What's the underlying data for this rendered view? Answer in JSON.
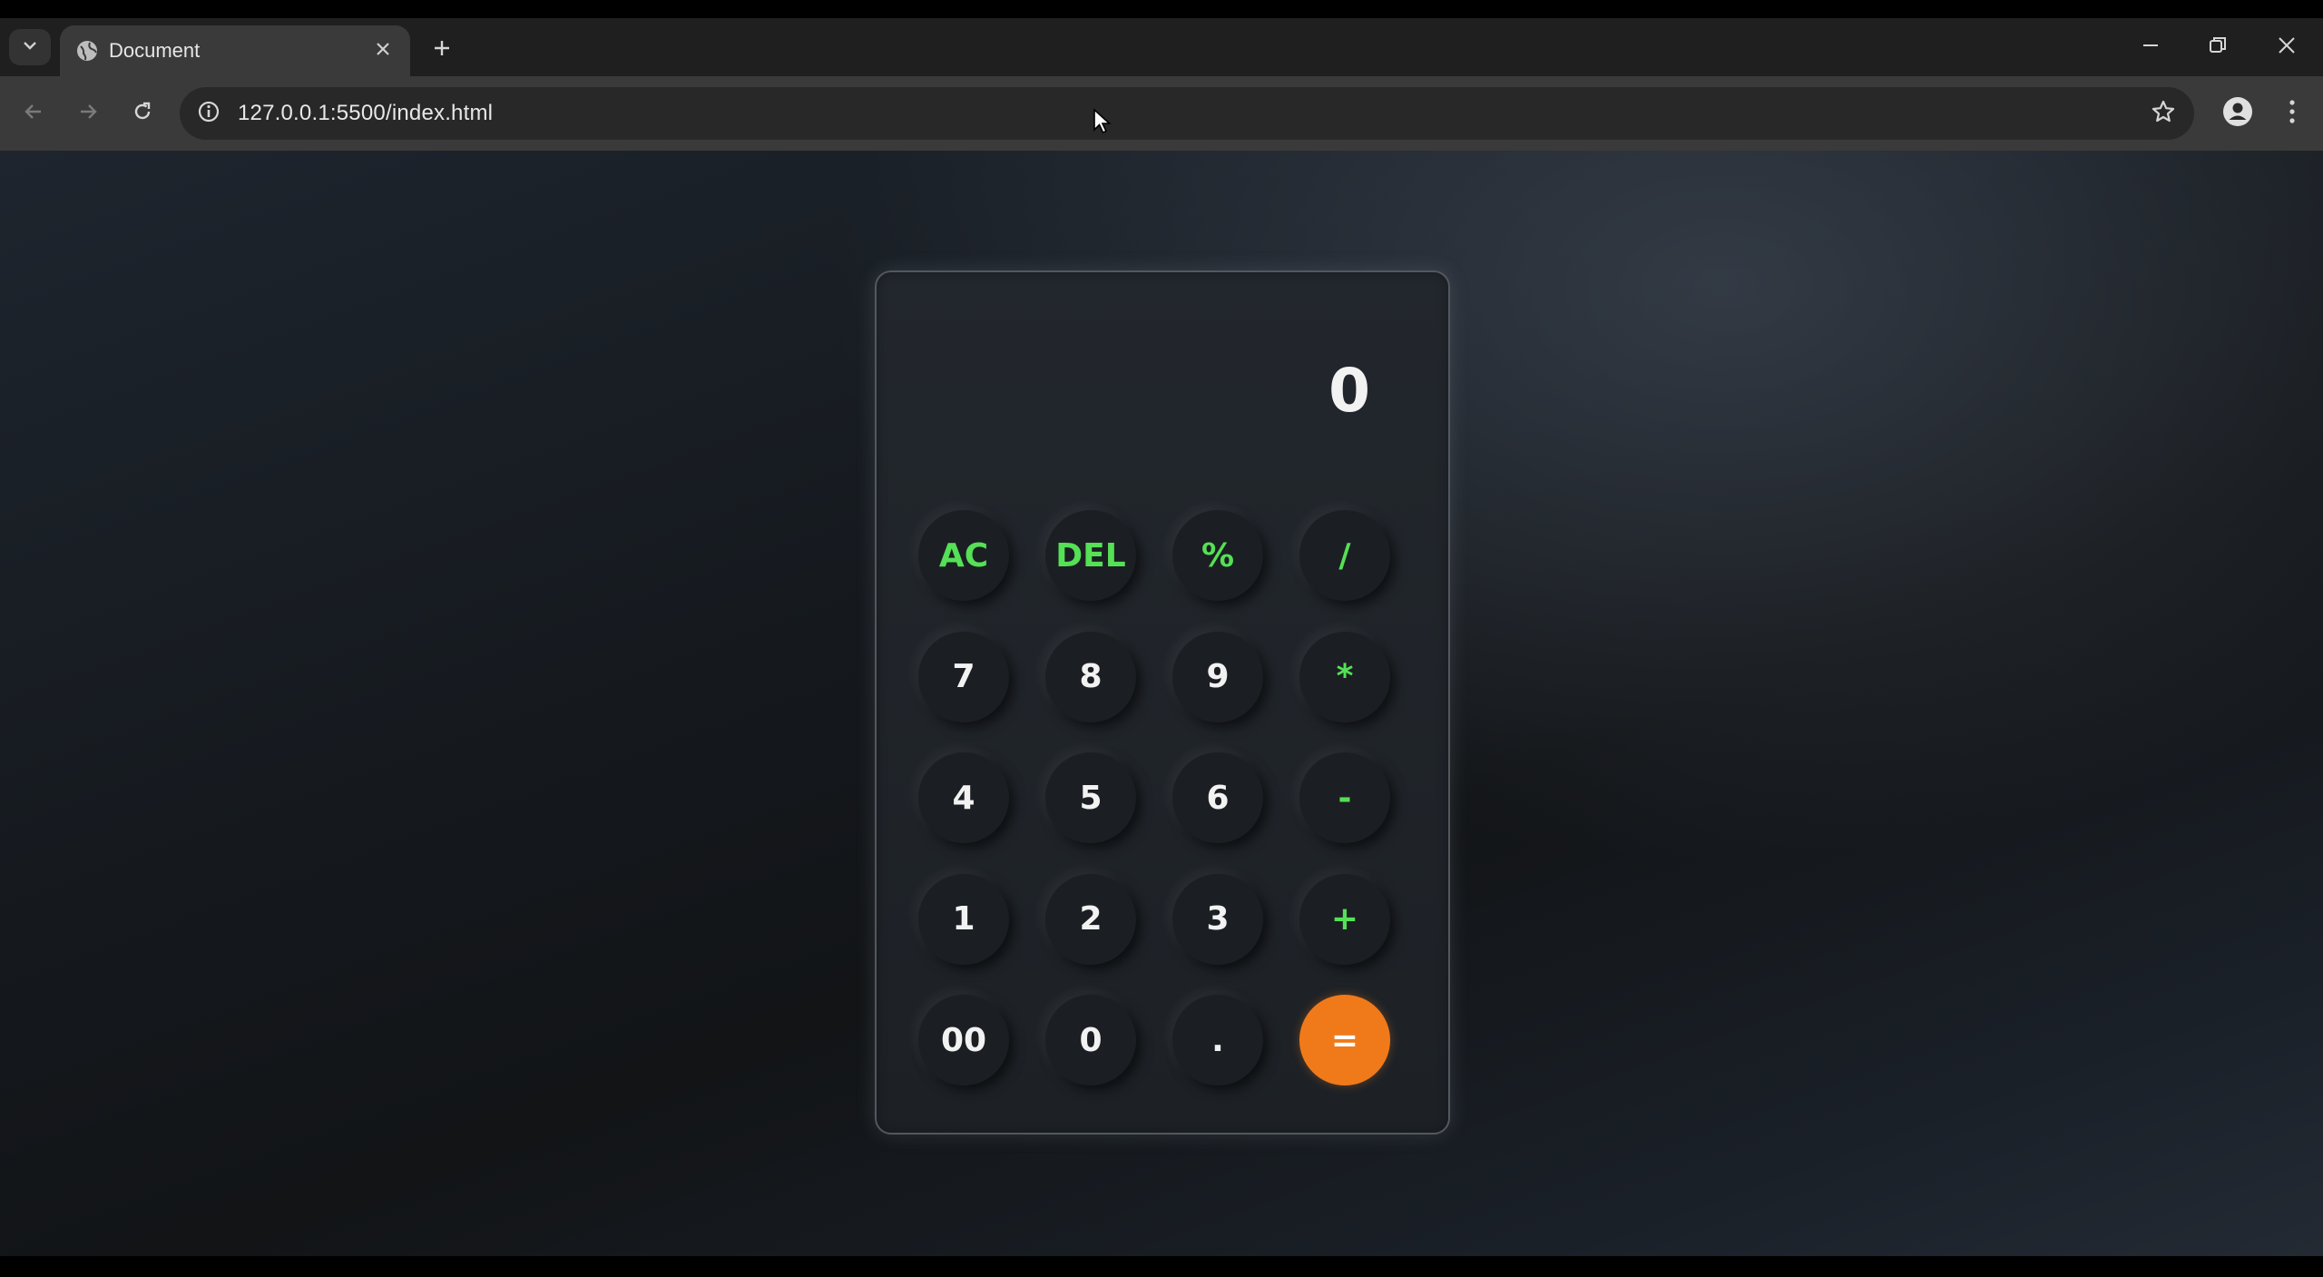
{
  "browser": {
    "tab_title": "Document",
    "url": "127.0.0.1:5500/index.html"
  },
  "icons": {
    "tab_search": "chevron-down-icon",
    "favicon": "globe-icon",
    "tab_close": "close-icon",
    "new_tab": "plus-icon",
    "minimize": "minimize-icon",
    "restore": "restore-icon",
    "window_close": "close-icon",
    "back": "arrow-left-icon",
    "forward": "arrow-right-icon",
    "reload": "reload-icon",
    "site_info": "info-icon",
    "bookmark": "star-icon",
    "profile": "person-icon",
    "menu": "more-vertical-icon"
  },
  "calculator": {
    "display": "0",
    "keys": [
      {
        "label": "AC",
        "style": "green"
      },
      {
        "label": "DEL",
        "style": "green"
      },
      {
        "label": "%",
        "style": "green"
      },
      {
        "label": "/",
        "style": "green"
      },
      {
        "label": "7",
        "style": "plain"
      },
      {
        "label": "8",
        "style": "plain"
      },
      {
        "label": "9",
        "style": "plain"
      },
      {
        "label": "*",
        "style": "green"
      },
      {
        "label": "4",
        "style": "plain"
      },
      {
        "label": "5",
        "style": "plain"
      },
      {
        "label": "6",
        "style": "plain"
      },
      {
        "label": "-",
        "style": "green"
      },
      {
        "label": "1",
        "style": "plain"
      },
      {
        "label": "2",
        "style": "plain"
      },
      {
        "label": "3",
        "style": "plain"
      },
      {
        "label": "+",
        "style": "green"
      },
      {
        "label": "00",
        "style": "plain"
      },
      {
        "label": "0",
        "style": "plain"
      },
      {
        "label": ".",
        "style": "plain"
      },
      {
        "label": "=",
        "style": "equals"
      }
    ]
  },
  "colors": {
    "accent_green": "#55e055",
    "equals_orange": "#f07a1a"
  }
}
